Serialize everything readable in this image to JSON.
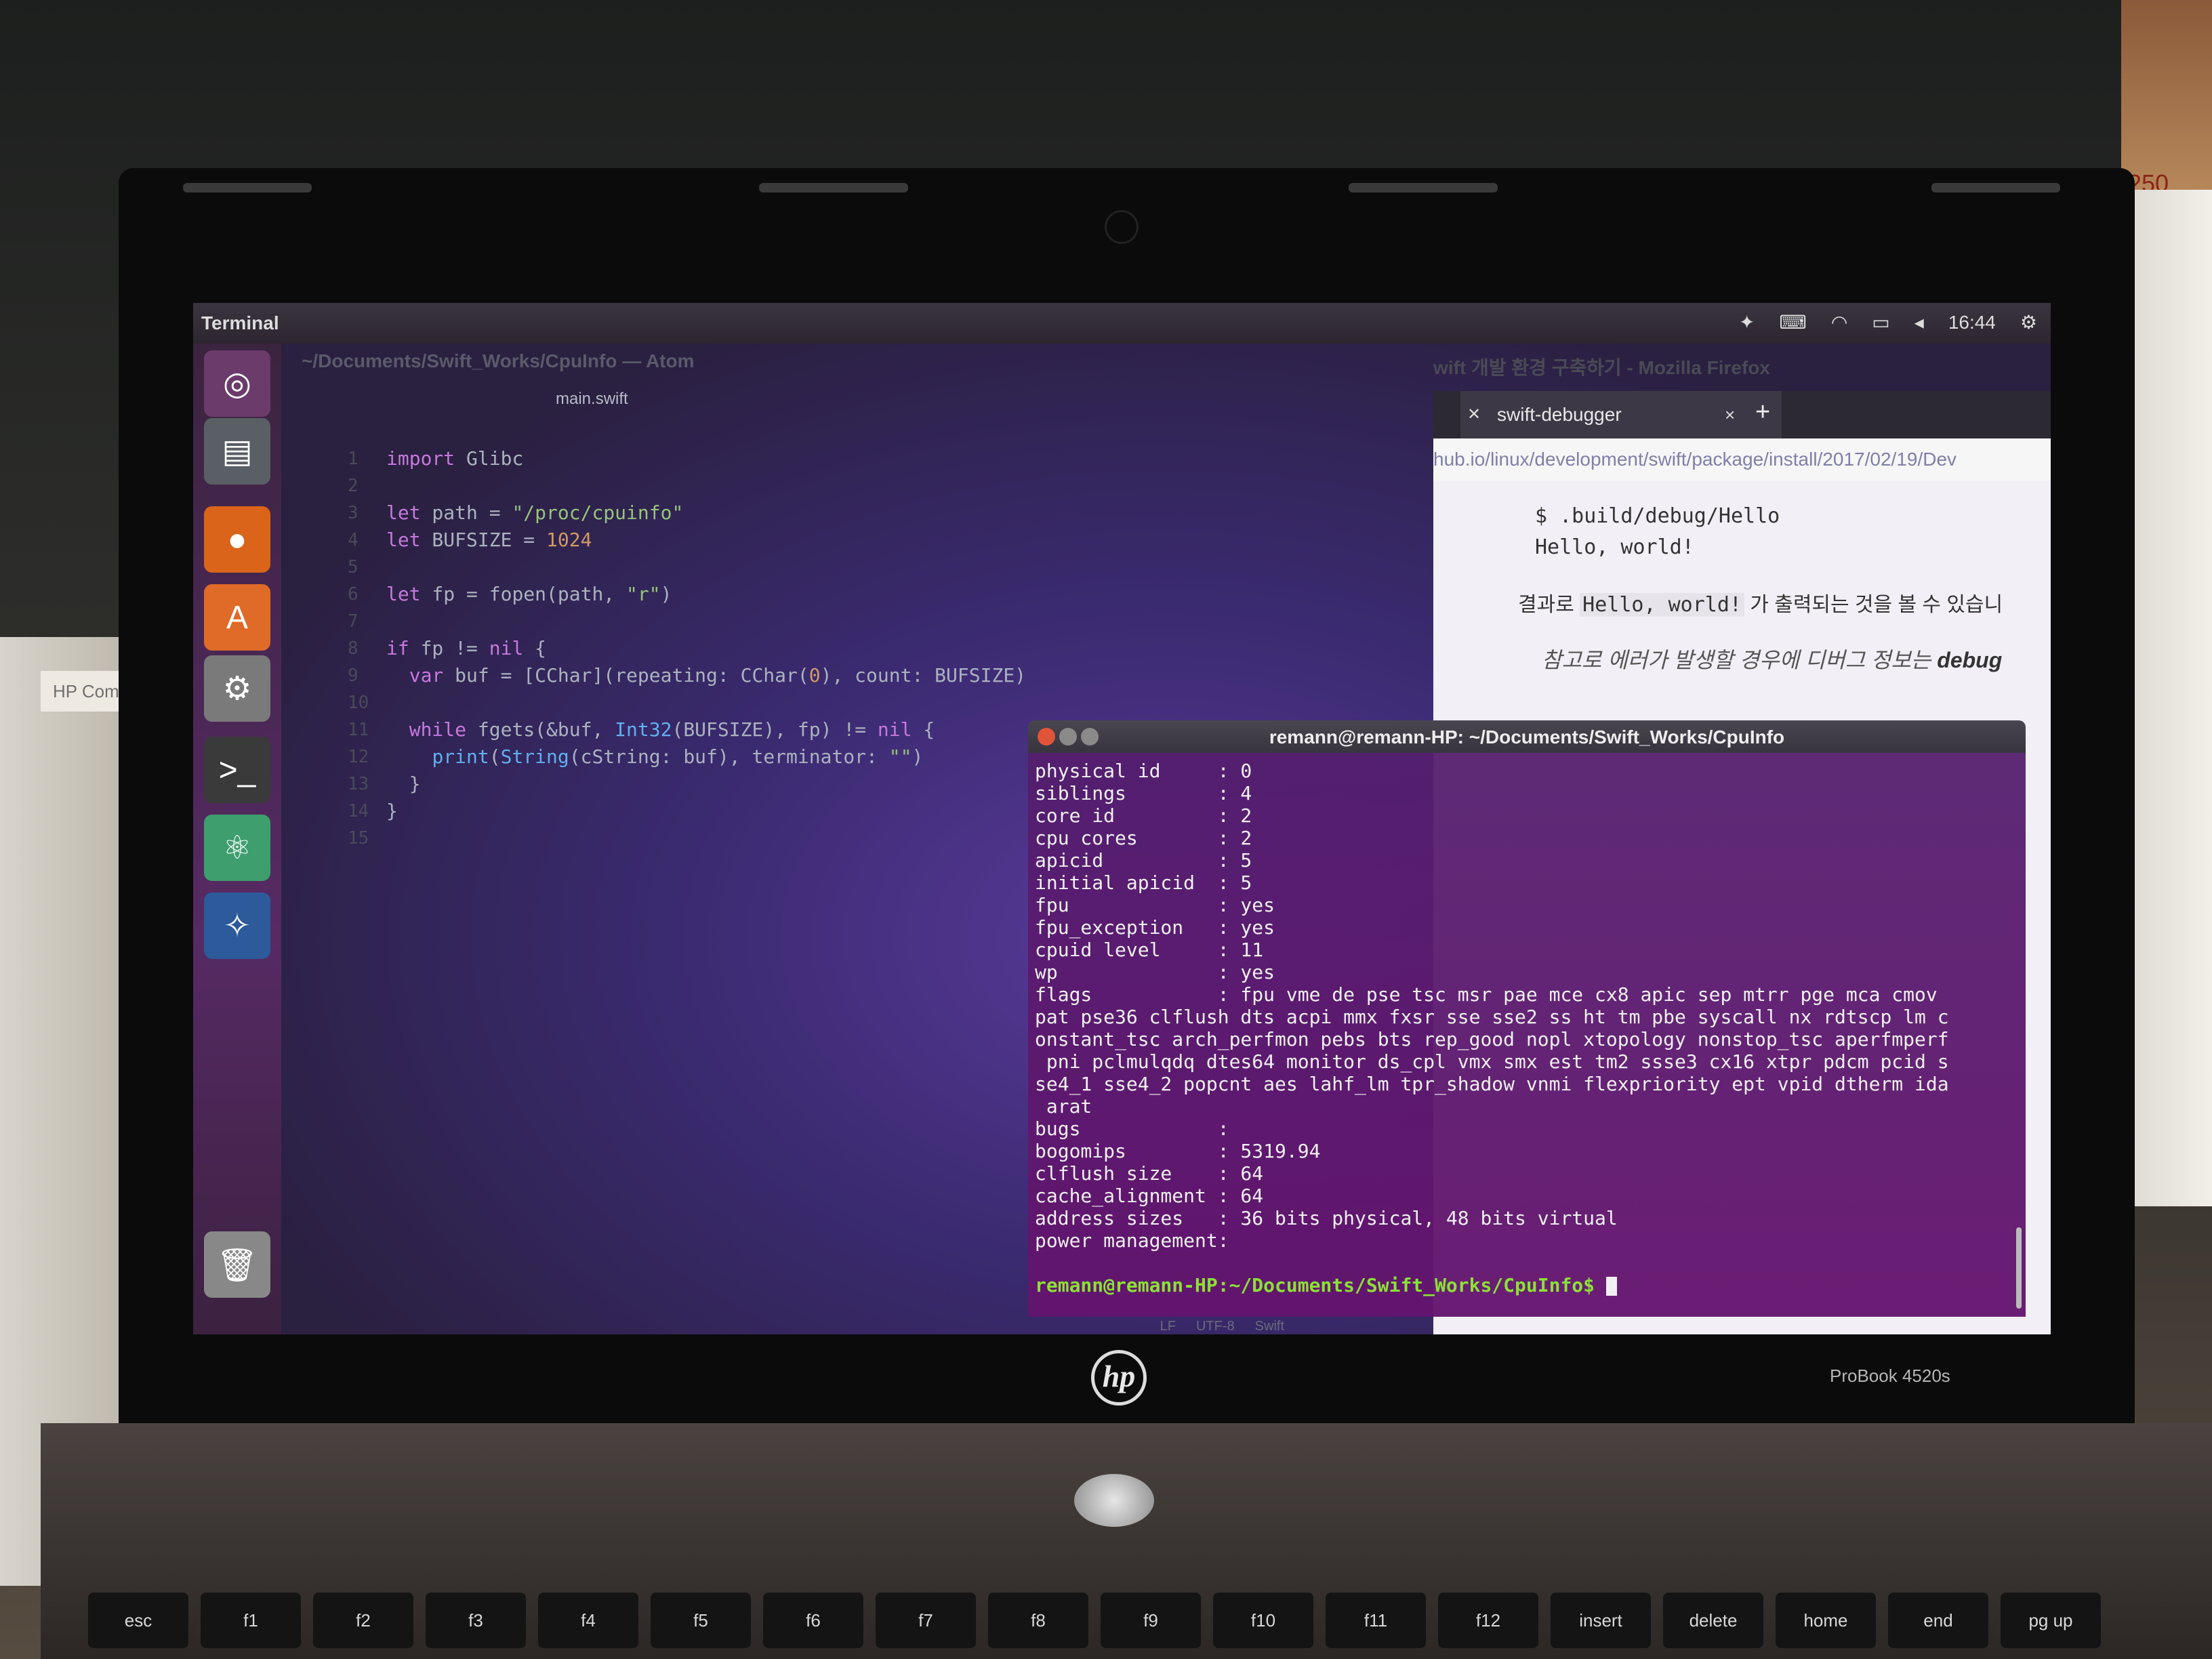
{
  "environment": {
    "laptop_brand_logo": "hp",
    "laptop_model": "ProBook 4520s",
    "wall_label": "HP Comp",
    "box_label": "250"
  },
  "ubuntu": {
    "topbar_title": "Terminal",
    "clock": "16:44",
    "tray_icons": [
      "dropbox-icon",
      "keyboard-icon",
      "wifi-icon",
      "battery-icon",
      "volume-icon",
      "settings-gear-icon"
    ]
  },
  "launcher": {
    "items": [
      {
        "name": "ubuntu-dash-icon",
        "glyph": "◎",
        "color": "#6b3b6b"
      },
      {
        "name": "files-icon",
        "glyph": "▤",
        "color": "#5a5f66"
      },
      {
        "name": "firefox-icon",
        "glyph": "●",
        "color": "#d9641a"
      },
      {
        "name": "software-center-icon",
        "glyph": "A",
        "color": "#e06a28"
      },
      {
        "name": "system-settings-icon",
        "glyph": "⚙",
        "color": "#7a7a7a"
      },
      {
        "name": "terminal-icon",
        "glyph": ">_",
        "color": "#3a3a3a"
      },
      {
        "name": "atom-icon",
        "glyph": "⚛",
        "color": "#3e9e6e"
      },
      {
        "name": "mysql-workbench-icon",
        "glyph": "✧",
        "color": "#2c5a9a"
      },
      {
        "name": "trash-icon",
        "glyph": "🗑",
        "color": "#888888"
      }
    ]
  },
  "atom": {
    "window_title": "~/Documents/Swift_Works/CpuInfo — Atom",
    "tab": "main.swift",
    "line_numbers": [
      "1",
      "2",
      "3",
      "4",
      "5",
      "6",
      "7",
      "8",
      "9",
      "10",
      "11",
      "12",
      "13",
      "14",
      "15"
    ],
    "code_lines": [
      "import Glibc",
      "",
      "let path = \"/proc/cpuinfo\"",
      "let BUFSIZE = 1024",
      "",
      "let fp = fopen(path, \"r\")",
      "",
      "if fp != nil {",
      "  var buf = [CChar](repeating: CChar(0), count: BUFSIZE)",
      "",
      "  while fgets(&buf, Int32(BUFSIZE), fp) != nil {",
      "    print(String(cString: buf), terminator: \"\")",
      "  }",
      "}",
      ""
    ],
    "status": [
      "LF",
      "UTF-8",
      "Swift"
    ]
  },
  "firefox": {
    "window_title": "wift 개발 환경 구축하기 - Mozilla Firefox",
    "tab_label": "swift-debugger",
    "url": "hub.io/linux/development/swift/package/install/2017/02/19/Dev",
    "pre_lines": [
      "$ .build/debug/Hello",
      "Hello, world!"
    ],
    "p1_before": "결과로 ",
    "p1_code": "Hello, world!",
    "p1_after": " 가 출력되는 것을 볼 수 있습니",
    "p2_text": "참고로 에러가 발생할 경우에 디버그 정보는 ",
    "p2_bold": "debug"
  },
  "terminal": {
    "title": "remann@remann-HP: ~/Documents/Swift_Works/CpuInfo",
    "lines": [
      "physical id     : 0",
      "siblings        : 4",
      "core id         : 2",
      "cpu cores       : 2",
      "apicid          : 5",
      "initial apicid  : 5",
      "fpu             : yes",
      "fpu_exception   : yes",
      "cpuid level     : 11",
      "wp              : yes",
      "flags           : fpu vme de pse tsc msr pae mce cx8 apic sep mtrr pge mca cmov",
      "pat pse36 clflush dts acpi mmx fxsr sse sse2 ss ht tm pbe syscall nx rdtscp lm c",
      "onstant_tsc arch_perfmon pebs bts rep_good nopl xtopology nonstop_tsc aperfmperf",
      " pni pclmulqdq dtes64 monitor ds_cpl vmx smx est tm2 ssse3 cx16 xtpr pdcm pcid s",
      "se4_1 sse4_2 popcnt aes lahf_lm tpr_shadow vnmi flexpriority ept vpid dtherm ida",
      " arat",
      "bugs            :",
      "bogomips        : 5319.94",
      "clflush size    : 64",
      "cache_alignment : 64",
      "address sizes   : 36 bits physical, 48 bits virtual",
      "power management:",
      ""
    ],
    "prompt": "remann@remann-HP:~/Documents/Swift_Works/CpuInfo$ "
  },
  "keyboard": {
    "keys": [
      "esc",
      "f1",
      "f2",
      "f3",
      "f4",
      "f5",
      "f6",
      "f7",
      "f8",
      "f9",
      "f10",
      "f11",
      "f12",
      "insert",
      "delete",
      "home",
      "end",
      "pg up"
    ]
  }
}
